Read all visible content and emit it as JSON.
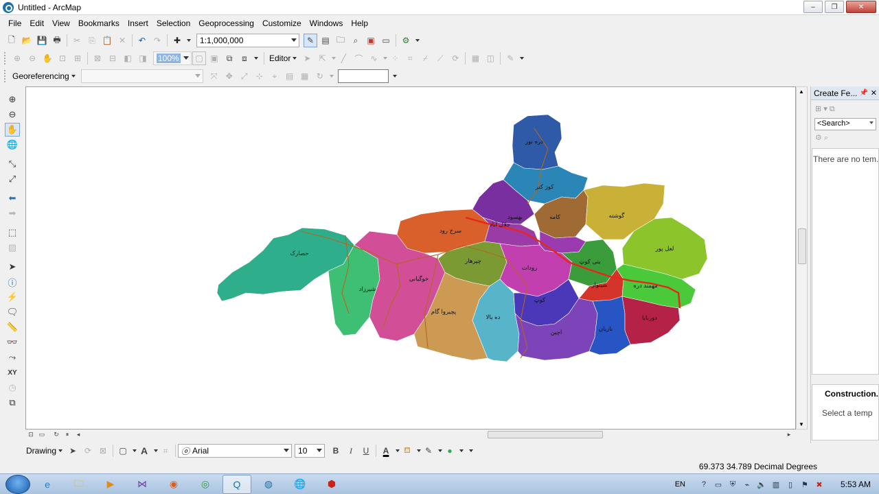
{
  "window": {
    "title": "Untitled - ArcMap",
    "controls": {
      "minimize": "–",
      "maximize": "❐",
      "close": "✕"
    }
  },
  "menu": [
    "File",
    "Edit",
    "View",
    "Bookmarks",
    "Insert",
    "Selection",
    "Geoprocessing",
    "Customize",
    "Windows",
    "Help"
  ],
  "standard_toolbar": {
    "scale": "1:1,000,000"
  },
  "editor_toolbar": {
    "editor_label": "Editor",
    "zoom_value": "100%"
  },
  "georef_toolbar": {
    "label": "Georeferencing",
    "layer_combo": "",
    "text_box": ""
  },
  "map": {
    "labels": [
      "دره نور",
      "کوز کنر",
      "جلال آباد",
      "بهسود",
      "کامه",
      "گوشته",
      "لعل پور",
      "سرخ رود",
      "حصارک",
      "شیرزاد",
      "خوگیانی",
      "چپرهار",
      "رودات",
      "بتی کوټ",
      "شینوار",
      "مهمند دره",
      "پچیروا گام",
      "ده بالا",
      "کوټ",
      "اچین",
      "نازیان",
      "دوربابا"
    ],
    "colors": {
      "river": "#b5651d",
      "road": "#e8251b"
    }
  },
  "right_panel": {
    "title": "Create Fe...",
    "search_placeholder": "<Search>",
    "empty_message": "There are no tem...",
    "construction_title": "Construction...",
    "construction_text": "Select a temp"
  },
  "drawing_toolbar": {
    "drawing_label": "Drawing",
    "font_name": "Arial",
    "font_size": "10",
    "bold": "B",
    "italic": "I",
    "underline": "U"
  },
  "status": {
    "coordinates": "69.373  34.789 Decimal Degrees"
  },
  "taskbar": {
    "language": "EN",
    "time": "5:53 AM"
  }
}
